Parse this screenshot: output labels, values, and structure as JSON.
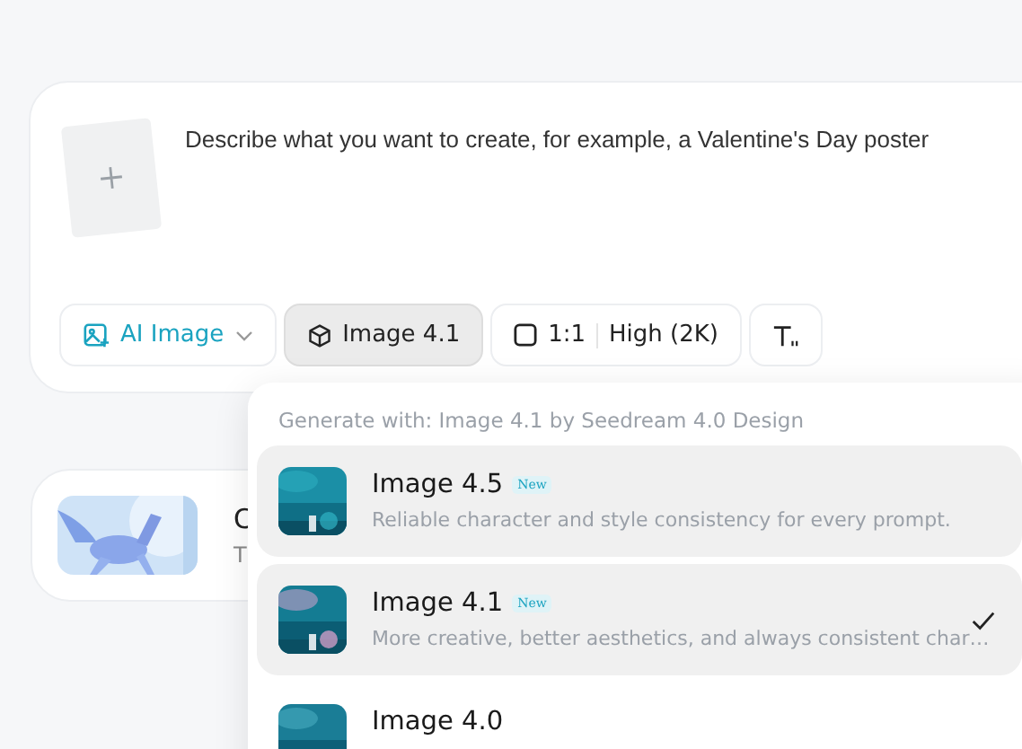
{
  "prompt": {
    "placeholder": "Describe what you want to create, for example, a Valentine's Day poster"
  },
  "toolbar": [
    {
      "kind": "mode",
      "label": "AI Image",
      "selected": false
    },
    {
      "kind": "model",
      "label": "Image 4.1",
      "selected": true
    },
    {
      "kind": "ratio",
      "ratio": "1:1",
      "quality": "High (2K)",
      "selected": false
    },
    {
      "kind": "text-style",
      "selected": false
    }
  ],
  "background_card": {
    "title": "C",
    "subtitle": "T"
  },
  "model_menu": {
    "header": "Generate with: Image 4.1 by Seedream 4.0 Design",
    "items": [
      {
        "name": "Image 4.5",
        "badge": "New",
        "description": "Reliable character and style consistency for every prompt.",
        "hovered": true,
        "selected": false
      },
      {
        "name": "Image 4.1",
        "badge": "New",
        "description": "More creative, better aesthetics, and always consistent char…",
        "hovered": false,
        "selected": true
      },
      {
        "name": "Image 4.0",
        "hovered": false,
        "selected": false
      }
    ]
  }
}
